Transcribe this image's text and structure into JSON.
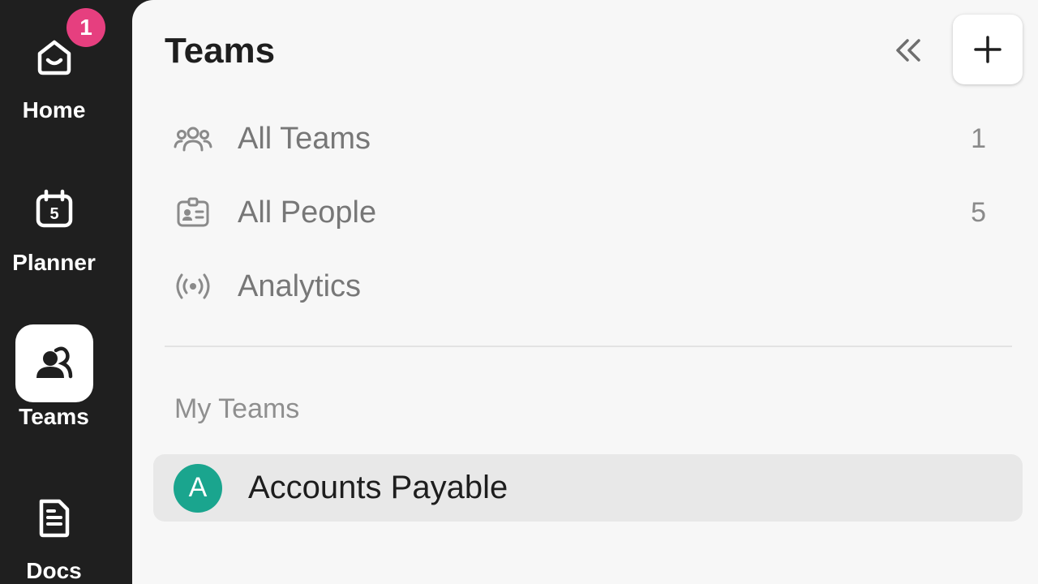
{
  "sidebar": {
    "items": [
      {
        "label": "Home",
        "icon": "home-icon",
        "badge": "1"
      },
      {
        "label": "Planner",
        "icon": "calendar-icon",
        "day": "5"
      },
      {
        "label": "Teams",
        "icon": "teams-icon",
        "active": true
      },
      {
        "label": "Docs",
        "icon": "document-icon"
      }
    ]
  },
  "panel": {
    "title": "Teams",
    "collapse_icon": "double-chevron-left-icon",
    "add_icon": "plus-icon",
    "nav": [
      {
        "label": "All Teams",
        "icon": "people-group-icon",
        "count": "1"
      },
      {
        "label": "All People",
        "icon": "id-card-icon",
        "count": "5"
      },
      {
        "label": "Analytics",
        "icon": "broadcast-icon",
        "count": ""
      }
    ],
    "section_label": "My Teams",
    "teams": [
      {
        "initial": "A",
        "name": "Accounts Payable",
        "avatar_color": "#1aa58e"
      }
    ]
  },
  "colors": {
    "rail_bg": "#1f1f1f",
    "panel_bg": "#f7f7f7",
    "badge": "#e63f7f",
    "accent_avatar": "#1aa58e",
    "selected_row": "#e8e8e8"
  }
}
